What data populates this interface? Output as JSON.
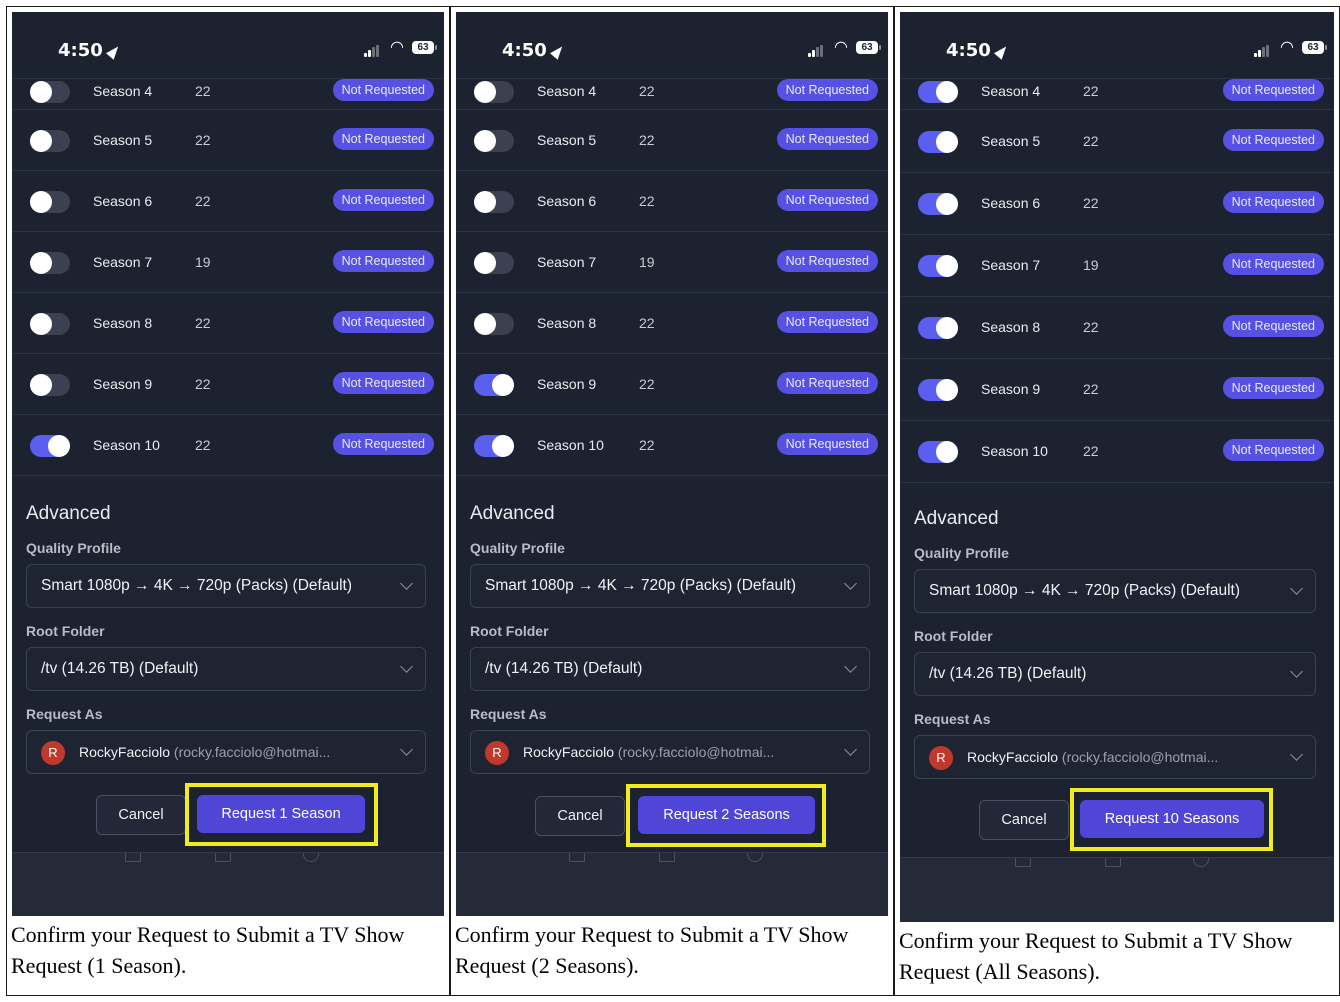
{
  "status": {
    "time": "4:50",
    "battery": "63"
  },
  "panels": [
    {
      "seasons": [
        {
          "name": "Season 4",
          "episodes": "22",
          "status": "Not Requested",
          "on": false
        },
        {
          "name": "Season 5",
          "episodes": "22",
          "status": "Not Requested",
          "on": false
        },
        {
          "name": "Season 6",
          "episodes": "22",
          "status": "Not Requested",
          "on": false
        },
        {
          "name": "Season 7",
          "episodes": "19",
          "status": "Not Requested",
          "on": false
        },
        {
          "name": "Season 8",
          "episodes": "22",
          "status": "Not Requested",
          "on": false
        },
        {
          "name": "Season 9",
          "episodes": "22",
          "status": "Not Requested",
          "on": false
        },
        {
          "name": "Season 10",
          "episodes": "22",
          "status": "Not Requested",
          "on": true
        }
      ],
      "advanced_title": "Advanced",
      "quality_label": "Quality Profile",
      "quality_value": "Smart 1080p → 4K → 720p (Packs) (Default)",
      "root_label": "Root Folder",
      "root_value": "/tv (14.26 TB) (Default)",
      "request_as_label": "Request As",
      "avatar_initial": "R",
      "user_name": "RockyFacciolo",
      "user_email": "(rocky.facciolo@hotmai...",
      "cancel_label": "Cancel",
      "request_label": "Request 1 Season",
      "caption": "Confirm your Request to Submit a TV Show Request (1 Season)."
    },
    {
      "seasons": [
        {
          "name": "Season 4",
          "episodes": "22",
          "status": "Not Requested",
          "on": false
        },
        {
          "name": "Season 5",
          "episodes": "22",
          "status": "Not Requested",
          "on": false
        },
        {
          "name": "Season 6",
          "episodes": "22",
          "status": "Not Requested",
          "on": false
        },
        {
          "name": "Season 7",
          "episodes": "19",
          "status": "Not Requested",
          "on": false
        },
        {
          "name": "Season 8",
          "episodes": "22",
          "status": "Not Requested",
          "on": false
        },
        {
          "name": "Season 9",
          "episodes": "22",
          "status": "Not Requested",
          "on": true
        },
        {
          "name": "Season 10",
          "episodes": "22",
          "status": "Not Requested",
          "on": true
        }
      ],
      "advanced_title": "Advanced",
      "quality_label": "Quality Profile",
      "quality_value": "Smart 1080p → 4K → 720p (Packs) (Default)",
      "root_label": "Root Folder",
      "root_value": "/tv (14.26 TB) (Default)",
      "request_as_label": "Request As",
      "avatar_initial": "R",
      "user_name": "RockyFacciolo",
      "user_email": "(rocky.facciolo@hotmai...",
      "cancel_label": "Cancel",
      "request_label": "Request 2 Seasons",
      "caption": "Confirm your Request to Submit a TV Show Request (2 Seasons)."
    },
    {
      "seasons": [
        {
          "name": "Season 4",
          "episodes": "22",
          "status": "Not Requested",
          "on": true
        },
        {
          "name": "Season 5",
          "episodes": "22",
          "status": "Not Requested",
          "on": true
        },
        {
          "name": "Season 6",
          "episodes": "22",
          "status": "Not Requested",
          "on": true
        },
        {
          "name": "Season 7",
          "episodes": "19",
          "status": "Not Requested",
          "on": true
        },
        {
          "name": "Season 8",
          "episodes": "22",
          "status": "Not Requested",
          "on": true
        },
        {
          "name": "Season 9",
          "episodes": "22",
          "status": "Not Requested",
          "on": true
        },
        {
          "name": "Season 10",
          "episodes": "22",
          "status": "Not Requested",
          "on": true
        }
      ],
      "advanced_title": "Advanced",
      "quality_label": "Quality Profile",
      "quality_value": "Smart 1080p → 4K → 720p (Packs) (Default)",
      "root_label": "Root Folder",
      "root_value": "/tv (14.26 TB) (Default)",
      "request_as_label": "Request As",
      "avatar_initial": "R",
      "user_name": "RockyFacciolo",
      "user_email": "(rocky.facciolo@hotmai...",
      "cancel_label": "Cancel",
      "request_label": "Request 10 Seasons",
      "caption": "Confirm your Request to Submit a TV Show Request (All Seasons)."
    }
  ],
  "colors": {
    "background": "#1d2230",
    "accent": "#5650e3",
    "highlight": "#f0ec1f"
  }
}
